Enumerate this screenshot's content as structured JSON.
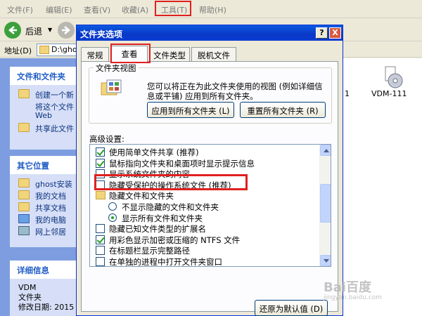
{
  "menubar": {
    "items": [
      "文件(F)",
      "编辑(E)",
      "查看(V)",
      "收藏(A)",
      "工具(T)",
      "帮助(H)"
    ]
  },
  "toolbar": {
    "back_label": "后退"
  },
  "address": {
    "label": "地址(D)",
    "path": "D:\\ghos"
  },
  "left_panels": {
    "tasks": {
      "title": "文件和文件夹",
      "items": [
        "创建一个新",
        "将这个文件",
        "Web",
        "共享此文件"
      ]
    },
    "other": {
      "title": "其它位置",
      "items": [
        "ghost安装",
        "我的文档",
        "共享文档",
        "我的电脑",
        "网上邻居"
      ]
    },
    "details": {
      "title": "详细信息",
      "name": "VDM",
      "type": "文件夹",
      "modified": "修改日期: 2015"
    }
  },
  "right_pane": {
    "num_label": "1",
    "file_label": "VDM-111"
  },
  "dialog": {
    "title": "文件夹选项",
    "help_btn": "?",
    "close_btn": "X",
    "tabs": [
      "常规",
      "查看",
      "文件类型",
      "脱机文件"
    ],
    "active_tab": "查看",
    "folder_view": {
      "group_title": "文件夹视图",
      "description": "您可以将正在为此文件夹使用的视图 (例如详细信息或平铺) 应用到所有文件夹。",
      "apply_all": "应用到所有文件夹 (L)",
      "reset_all": "重置所有文件夹 (R)"
    },
    "advanced_label": "高级设置:",
    "advanced_rows": [
      {
        "kind": "checkbox",
        "checked": true,
        "indent": 0,
        "text": "使用简单文件共享 (推荐)"
      },
      {
        "kind": "checkbox",
        "checked": true,
        "indent": 0,
        "text": "鼠标指向文件夹和桌面项时显示提示信息"
      },
      {
        "kind": "checkbox",
        "checked": false,
        "indent": 0,
        "text": "显示系统文件夹的内容"
      },
      {
        "kind": "checkbox",
        "checked": false,
        "indent": 0,
        "text": "隐藏受保护的操作系统文件 (推荐)"
      },
      {
        "kind": "folder",
        "checked": false,
        "indent": 0,
        "text": "隐藏文件和文件夹"
      },
      {
        "kind": "radio",
        "checked": false,
        "indent": 1,
        "text": "不显示隐藏的文件和文件夹"
      },
      {
        "kind": "radio",
        "checked": true,
        "indent": 1,
        "text": "显示所有文件和文件夹"
      },
      {
        "kind": "checkbox",
        "checked": false,
        "indent": 0,
        "text": "隐藏已知文件类型的扩展名"
      },
      {
        "kind": "checkbox",
        "checked": true,
        "indent": 0,
        "text": "用彩色显示加密或压缩的 NTFS 文件"
      },
      {
        "kind": "checkbox",
        "checked": false,
        "indent": 0,
        "text": "在标题栏显示完整路径"
      },
      {
        "kind": "checkbox",
        "checked": false,
        "indent": 0,
        "text": "在单独的进程中打开文件夹窗口"
      }
    ],
    "restore_defaults": "还原为默认值 (D)"
  },
  "watermark": {
    "brand": "Bai百度",
    "sub": "jingyan.baidu.com"
  },
  "colors": {
    "highlight": "#e02020",
    "title_blue": "#0a3cd0",
    "panel_blue": "#7d9de0"
  }
}
